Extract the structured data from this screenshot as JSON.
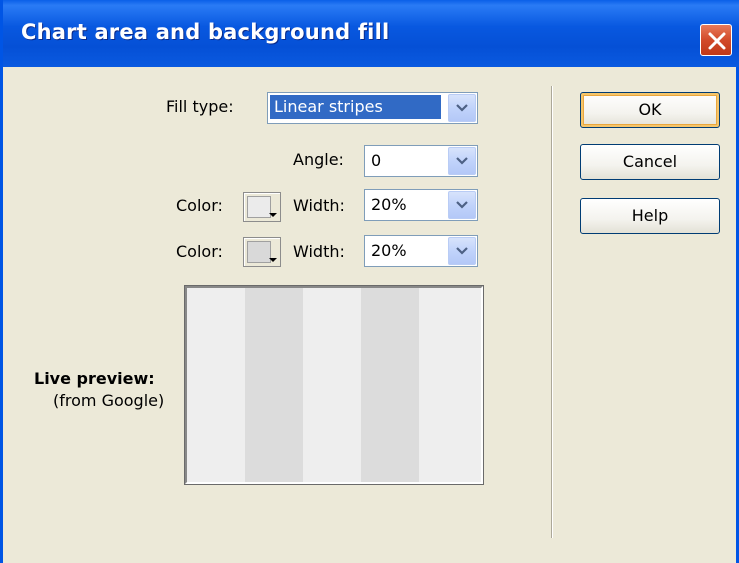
{
  "window": {
    "title": "Chart area and background fill",
    "close_icon": "close-icon"
  },
  "form": {
    "fill_type_label": "Fill type:",
    "fill_type_value": "Linear stripes",
    "angle_label": "Angle:",
    "angle_value": "0",
    "color1_label": "Color:",
    "width1_label": "Width:",
    "width1_value": "20%",
    "color2_label": "Color:",
    "width2_label": "Width:",
    "width2_value": "20%",
    "color1_swatch": "#ebebeb",
    "color2_swatch": "#d9d9d9"
  },
  "preview": {
    "label": "Live preview:",
    "sublabel": "(from Google)",
    "stripe_colors": [
      "#eeeeee",
      "#dcdcdc"
    ]
  },
  "buttons": {
    "ok": "OK",
    "cancel": "Cancel",
    "help": "Help"
  },
  "colors": {
    "titlebar": "#0a5ae0",
    "dialog_bg": "#ece9d8",
    "selection": "#316ac5"
  }
}
